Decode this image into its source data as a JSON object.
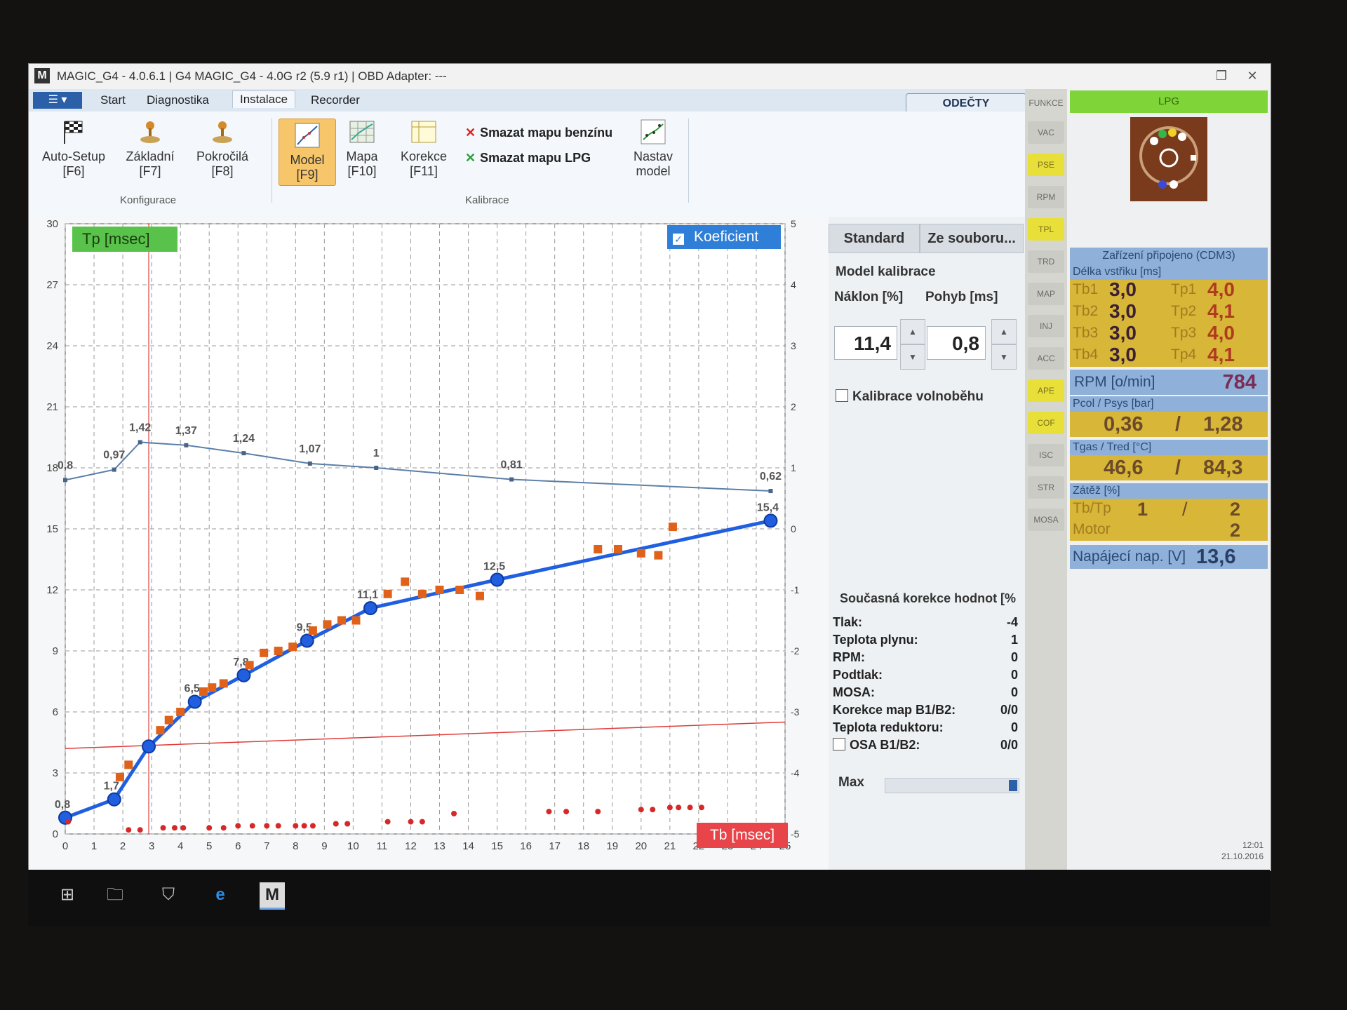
{
  "window": {
    "title": "MAGIC_G4 - 4.0.6.1  |  G4 MAGIC_G4 - 4.0G r2 (5.9 r1)  |  OBD Adapter: ---",
    "logo": "M",
    "minimize": "—",
    "restore": "❐",
    "close": "✕"
  },
  "tabs": [
    "Start",
    "Diagnostika",
    "Instalace",
    "Recorder"
  ],
  "active_tab": "Instalace",
  "odecty": "ODEČTY",
  "ribbon": {
    "auto_setup": [
      "Auto-Setup",
      "[F6]"
    ],
    "zakladni": [
      "Základní",
      "[F7]"
    ],
    "pokrocila": [
      "Pokročilá",
      "[F8]"
    ],
    "group1": "Konfigurace",
    "model": [
      "Model",
      "[F9]"
    ],
    "mapa": [
      "Mapa",
      "[F10]"
    ],
    "korekce": [
      "Korekce",
      "[F11]"
    ],
    "smazat_benzin": "Smazat mapu benzínu",
    "smazat_lpg": "Smazat mapu LPG",
    "nastav": [
      "Nastav",
      "model"
    ],
    "group2": "Kalibrace"
  },
  "chart_labels": {
    "tp": "Tp [msec]",
    "koeficient": "Koeficient",
    "tb": "Tb [msec]"
  },
  "chart_data": {
    "type": "line",
    "xlabel": "Tb [msec]",
    "ylabel": "Tp [msec]",
    "xlim": [
      0,
      25
    ],
    "ylim": [
      0,
      30
    ],
    "y2lim": [
      -5,
      5
    ],
    "x_ticks": [
      0,
      1,
      2,
      3,
      4,
      5,
      6,
      7,
      8,
      9,
      10,
      11,
      12,
      13,
      14,
      15,
      16,
      17,
      18,
      19,
      20,
      21,
      22,
      23,
      24,
      25
    ],
    "y_ticks": [
      0,
      3,
      6,
      9,
      12,
      15,
      18,
      21,
      24,
      27,
      30
    ],
    "y2_ticks": [
      -5,
      -4,
      -3,
      -2,
      -1,
      0,
      1,
      2,
      3,
      4,
      5
    ],
    "series": [
      {
        "kind": "model",
        "color": "#1f5fe0",
        "x": [
          0,
          1.7,
          2.9,
          4.5,
          6.2,
          8.4,
          10.6,
          15,
          24.5
        ],
        "y": [
          0.8,
          1.7,
          4.3,
          6.5,
          7.8,
          9.5,
          11.1,
          12.5,
          15.4
        ],
        "labels": [
          "0,8",
          "1,7",
          "",
          "6,5",
          "7,8",
          "9,5",
          "11,1",
          "12,5",
          "15,4"
        ]
      },
      {
        "kind": "koeficient",
        "color": "#5b7fa8",
        "axis": "y2",
        "x": [
          0,
          1.7,
          2.6,
          4.2,
          6.2,
          8.5,
          10.8,
          15.5,
          24.5
        ],
        "y": [
          0.8,
          0.97,
          1.42,
          1.37,
          1.24,
          1.07,
          1.0,
          0.81,
          0.62
        ],
        "labels": [
          "0,8",
          "0,97",
          "1,42",
          "1,37",
          "1,24",
          "1,07",
          "1",
          "0,81",
          "0,62"
        ]
      },
      {
        "kind": "measured",
        "color": "#e0621a",
        "x": [
          1.9,
          2.2,
          3.3,
          3.6,
          4.0,
          4.8,
          5.1,
          5.5,
          6.4,
          6.9,
          7.4,
          7.9,
          8.6,
          9.1,
          9.6,
          10.1,
          11.2,
          11.8,
          12.4,
          13.0,
          13.7,
          14.4,
          18.5,
          19.2,
          20.0,
          20.6,
          21.1
        ],
        "y": [
          2.8,
          3.4,
          5.1,
          5.6,
          6.0,
          7.0,
          7.2,
          7.4,
          8.3,
          8.9,
          9.0,
          9.2,
          10.0,
          10.3,
          10.5,
          10.5,
          11.8,
          12.4,
          11.8,
          12.0,
          12.0,
          11.7,
          14.0,
          14.0,
          13.8,
          13.7,
          15.1
        ]
      },
      {
        "kind": "zero-hits",
        "color": "#d62828",
        "x": [
          0.1,
          2.2,
          2.6,
          3.4,
          3.8,
          4.1,
          5.0,
          5.5,
          6.0,
          6.5,
          7.0,
          7.4,
          8.0,
          8.3,
          8.6,
          9.4,
          9.8,
          11.2,
          12.0,
          12.4,
          13.5,
          16.8,
          17.4,
          18.5,
          20.0,
          20.4,
          21.0,
          21.3,
          21.7,
          22.1
        ],
        "y": [
          0.6,
          0.2,
          0.2,
          0.3,
          0.3,
          0.3,
          0.3,
          0.3,
          0.4,
          0.4,
          0.4,
          0.4,
          0.4,
          0.4,
          0.4,
          0.5,
          0.5,
          0.6,
          0.6,
          0.6,
          1.0,
          1.1,
          1.1,
          1.1,
          1.2,
          1.2,
          1.3,
          1.3,
          1.3,
          1.3
        ]
      }
    ],
    "threshold_line": {
      "color": "#e03a3a",
      "y_start": 4.2,
      "y_end": 5.5
    },
    "cursor_x": 2.9
  },
  "mid": {
    "standard": "Standard",
    "ze_souboru": "Ze souboru...",
    "model_kalibrace": "Model kalibrace",
    "naklon_label": "Náklon [%]",
    "pohyb_label": "Pohyb [ms]",
    "naklon": "11,4",
    "pohyb": "0,8",
    "spin_up": "▲",
    "spin_dn": "▼",
    "kalibrace_volnobehu": "Kalibrace volnoběhu",
    "korekce_title": "Současná korekce hodnot [%",
    "korekce": [
      {
        "label": "Tlak:",
        "value": "-4"
      },
      {
        "label": "Teplota plynu:",
        "value": "1"
      },
      {
        "label": "RPM:",
        "value": "0"
      },
      {
        "label": "Podtlak:",
        "value": "0"
      },
      {
        "label": "MOSA:",
        "value": "0"
      },
      {
        "label": "Korekce map B1/B2:",
        "value": "0/0"
      },
      {
        "label": "Teplota reduktoru:",
        "value": "0"
      },
      {
        "label": "OSA B1/B2:",
        "value": "0/0"
      }
    ],
    "max": "Max"
  },
  "strip": {
    "title": "FUNKCE",
    "items": [
      "VAC",
      "PSE",
      "RPM",
      "TPL",
      "TRD",
      "MAP",
      "INJ",
      "ACC",
      "APE",
      "COF",
      "ISC",
      "STR",
      "MOSA"
    ],
    "yellow": [
      "PSE",
      "TPL",
      "APE",
      "COF"
    ]
  },
  "status": {
    "lpg": "LPG",
    "pripojeno": "Zařízení připojeno (CDM3)",
    "delka": "Délka vstřiku [ms]",
    "tb": [
      [
        "Tb1",
        "3,0"
      ],
      [
        "Tb2",
        "3,0"
      ],
      [
        "Tb3",
        "3,0"
      ],
      [
        "Tb4",
        "3,0"
      ]
    ],
    "tp": [
      [
        "Tp1",
        "4,0"
      ],
      [
        "Tp2",
        "4,1"
      ],
      [
        "Tp3",
        "4,0"
      ],
      [
        "Tp4",
        "4,1"
      ]
    ],
    "rpm_label": "RPM [o/min]",
    "rpm": "784",
    "pcol_label": "Pcol / Psys [bar]",
    "pcol": "0,36",
    "slash": "/",
    "psys": "1,28",
    "tgas_label": "Tgas / Tred [°C]",
    "tgas": "46,6",
    "tred": "84,3",
    "zatez_label": "Zátěž [%]",
    "tbtp_label": "Tb/Tp",
    "tbtp_a": "1",
    "tbtp_b": "2",
    "motor_label": "Motor",
    "motor": "2",
    "napajeci_label": "Napájecí nap. [V]",
    "napajeci": "13,6"
  },
  "taskbar": {
    "time": "12:01",
    "date": "21.10.2016",
    "app": "M",
    "ie": "e"
  }
}
